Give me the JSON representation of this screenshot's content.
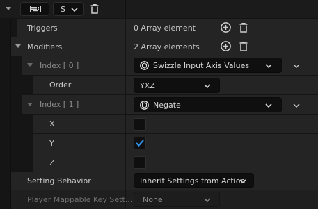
{
  "header": {
    "s_label": "S"
  },
  "rows": {
    "triggers": {
      "label": "Triggers",
      "value": "0 Array element"
    },
    "modifiers": {
      "label": "Modifiers",
      "value": "2 Array elements"
    },
    "index0": {
      "label": "Index [ 0 ]",
      "value": "Swizzle Input Axis Values"
    },
    "order": {
      "label": "Order",
      "value": "YXZ"
    },
    "index1": {
      "label": "Index [ 1 ]",
      "value": "Negate"
    },
    "x": {
      "label": "X",
      "checked": false
    },
    "y": {
      "label": "Y",
      "checked": true
    },
    "z": {
      "label": "Z",
      "checked": false
    },
    "setting_behavior": {
      "label": "Setting Behavior",
      "value": "Inherit Settings from Action"
    },
    "player_mappable": {
      "label": "Player Mappable Key Sett...",
      "value": "None"
    }
  },
  "colors": {
    "accent": "#2f8fe6",
    "row_bg": "#242424",
    "panel_bg": "#151515",
    "field_bg": "#0f0f0f"
  },
  "icons": {
    "add": "plus-circle-icon",
    "delete": "trash-icon",
    "class": "unreal-class-icon",
    "keyboard": "keyboard-icon",
    "expand": "chevron-down-icon"
  }
}
